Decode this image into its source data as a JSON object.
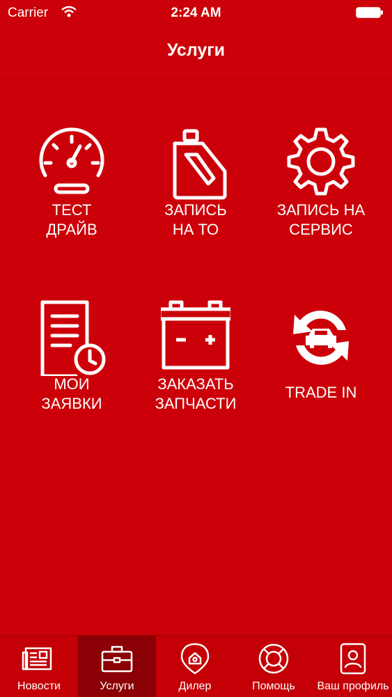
{
  "status_bar": {
    "carrier": "Carrier",
    "time": "2:24 AM"
  },
  "nav": {
    "title": "Услуги"
  },
  "services": [
    {
      "label": "ТЕСТ\nДРАЙВ",
      "icon": "speedometer-icon"
    },
    {
      "label": "ЗАПИСЬ\nНА ТО",
      "icon": "oil-canister-icon"
    },
    {
      "label": "ЗАПИСЬ НА\nСЕРВИС",
      "icon": "gear-icon"
    },
    {
      "label": "МОИ\nЗАЯВКИ",
      "icon": "document-clock-icon"
    },
    {
      "label": "ЗАКАЗАТЬ\nЗАПЧАСТИ",
      "icon": "car-battery-icon"
    },
    {
      "label": "TRADE IN",
      "icon": "car-exchange-icon"
    }
  ],
  "tabbar": {
    "tabs": [
      {
        "label": "Новости",
        "icon": "newspaper-icon"
      },
      {
        "label": "Услуги",
        "icon": "briefcase-icon",
        "active": true
      },
      {
        "label": "Дилер",
        "icon": "dealer-location-icon"
      },
      {
        "label": "Помощь",
        "icon": "lifebuoy-icon"
      },
      {
        "label": "Ваш профиль",
        "icon": "profile-card-icon"
      }
    ]
  },
  "colors": {
    "background": "#cc0008",
    "active_tab": "#8a0004",
    "foreground": "#ffffff"
  }
}
